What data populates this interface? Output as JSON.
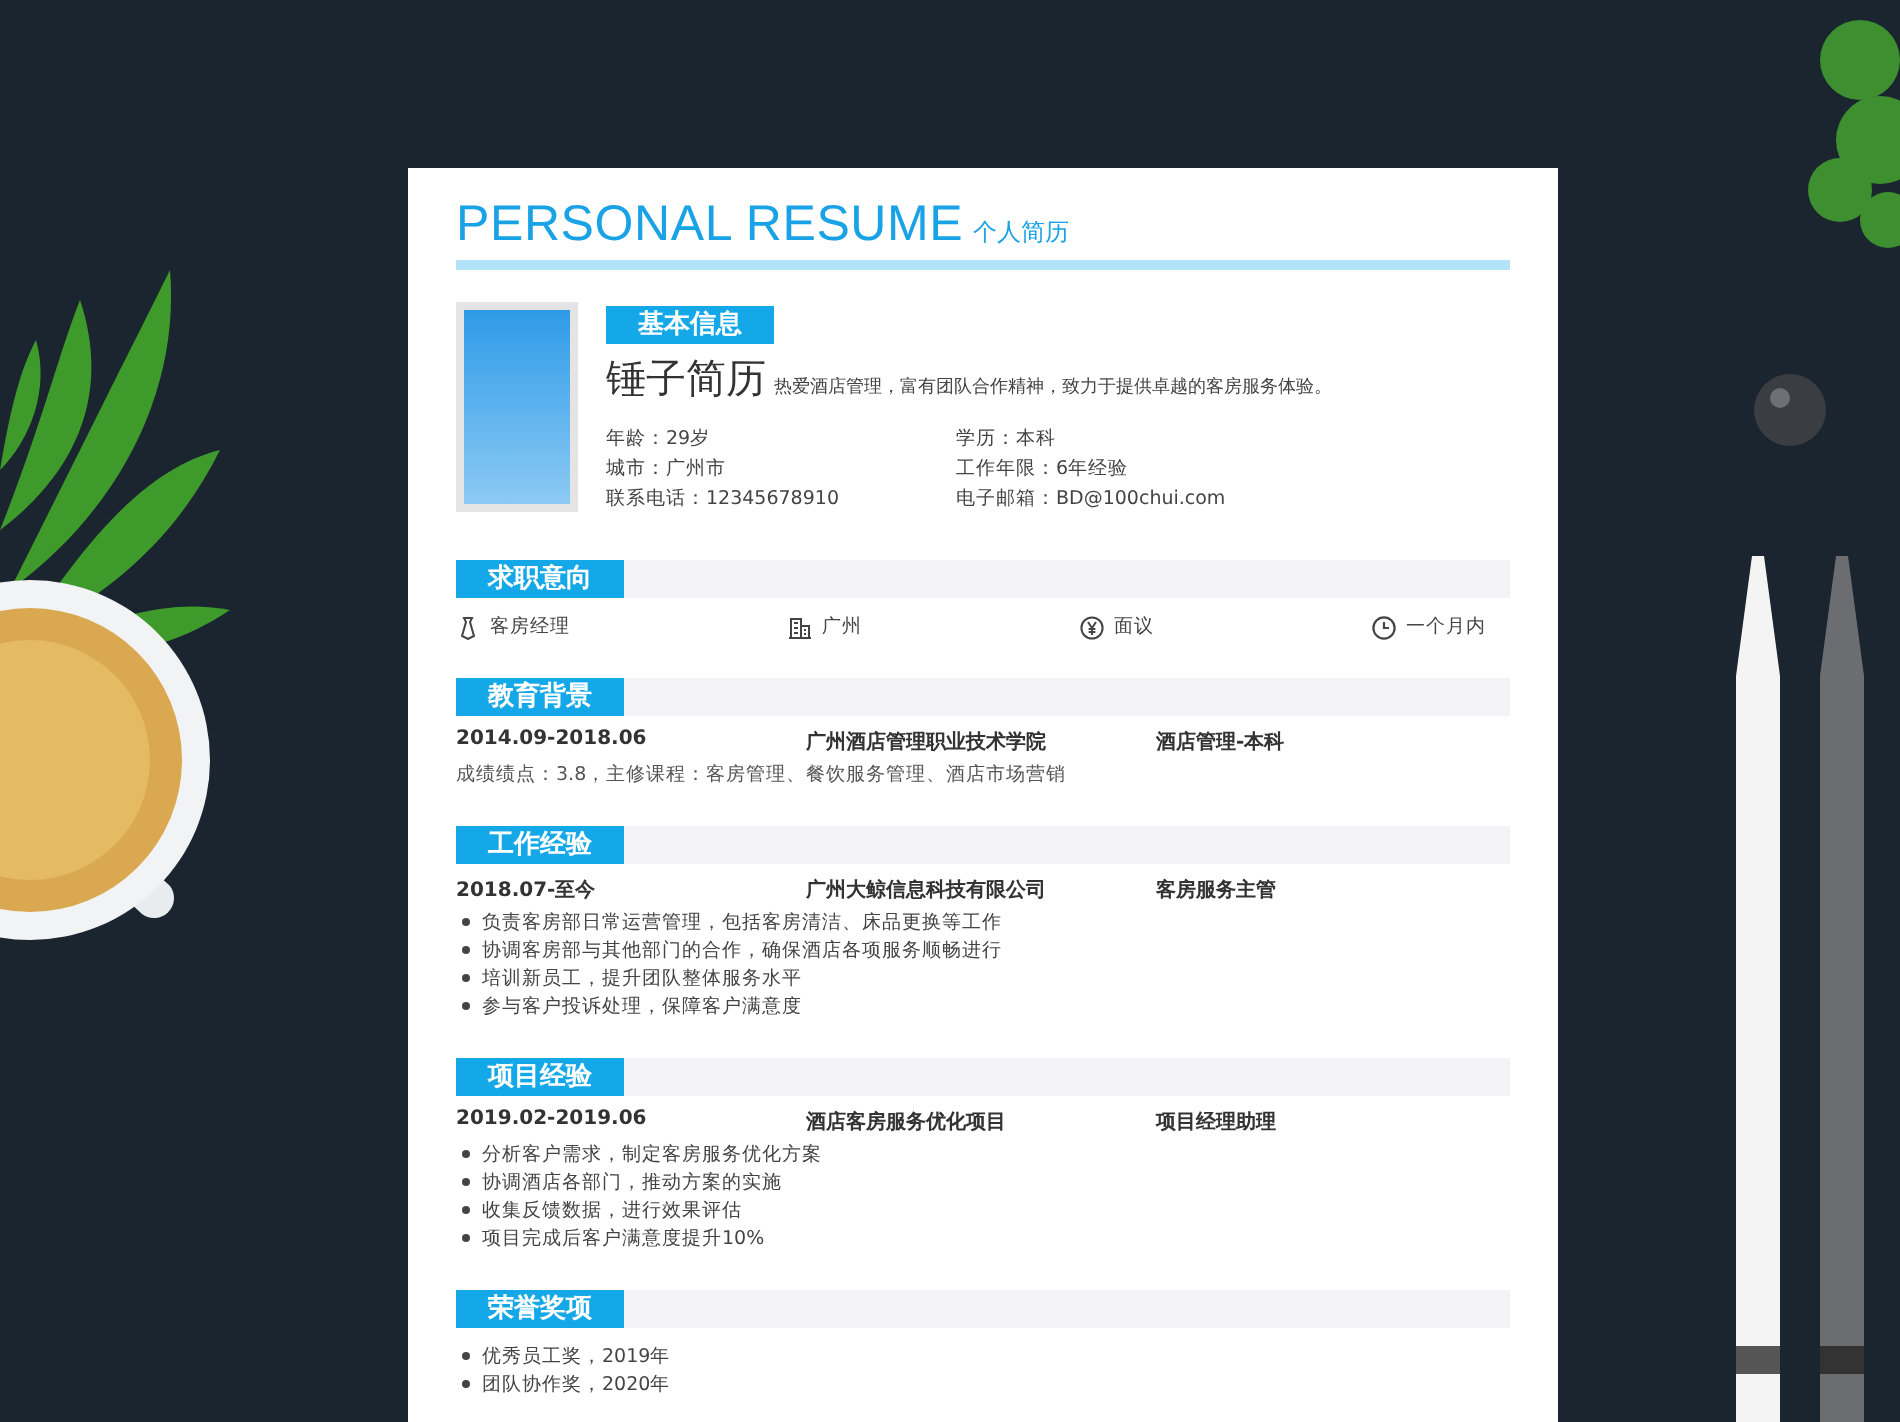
{
  "header": {
    "title": "PERSONAL RESUME",
    "subtitle": "个人简历"
  },
  "basic": {
    "heading": "基本信息",
    "name": "锤子简历",
    "summary": "热爱酒店管理，富有团队合作精神，致力于提供卓越的客房服务体验。",
    "fields": [
      "年龄：29岁",
      "学历：本科",
      "城市：广州市",
      "工作年限：6年经验",
      "联系电话：12345678910",
      "电子邮箱：BD@100chui.com"
    ]
  },
  "sections": [
    {
      "kind": "intent",
      "heading": "求职意向",
      "items": [
        "客房经理",
        "广州",
        "面议",
        "一个月内"
      ]
    },
    {
      "kind": "entry",
      "heading": "教育背景",
      "date": "2014.09-2018.06",
      "org": "广州酒店管理职业技术学院",
      "role": "酒店管理-本科",
      "note": "成绩绩点：3.8，主修课程：客房管理、餐饮服务管理、酒店市场营销"
    },
    {
      "kind": "entry",
      "heading": "工作经验",
      "date": "2018.07-至今",
      "org": "广州大鲸信息科技有限公司",
      "role": "客房服务主管",
      "bullets": [
        "负责客房部日常运营管理，包括客房清洁、床品更换等工作",
        "协调客房部与其他部门的合作，确保酒店各项服务顺畅进行",
        "培训新员工，提升团队整体服务水平",
        "参与客户投诉处理，保障客户满意度"
      ]
    },
    {
      "kind": "entry",
      "heading": "项目经验",
      "date": "2019.02-2019.06",
      "org": "酒店客房服务优化项目",
      "role": "项目经理助理",
      "bullets": [
        "分析客户需求，制定客房服务优化方案",
        "协调酒店各部门，推动方案的实施",
        "收集反馈数据，进行效果评估",
        "项目完成后客户满意度提升10%"
      ]
    },
    {
      "kind": "list",
      "heading": "荣誉奖项",
      "bullets": [
        "优秀员工奖，2019年",
        "团队协作奖，2020年"
      ]
    }
  ]
}
